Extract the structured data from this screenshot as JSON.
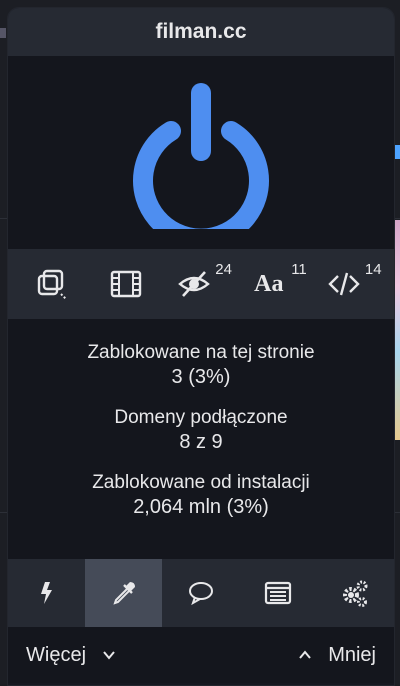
{
  "header": {
    "title": "filman.cc"
  },
  "power": {
    "icon": "power-icon",
    "state": "on",
    "color": "#4e8ef0"
  },
  "icon_row": [
    {
      "name": "no-popups-icon",
      "badge": ""
    },
    {
      "name": "no-media-icon",
      "badge": ""
    },
    {
      "name": "no-cosmetic-icon",
      "badge": "24"
    },
    {
      "name": "no-remote-fonts-icon",
      "glyph": "Aa",
      "badge": "11"
    },
    {
      "name": "no-scripting-icon",
      "badge": "14"
    }
  ],
  "stats": {
    "blocked_page_label": "Zablokowane na tej stronie",
    "blocked_page_value": "3 (3%)",
    "domains_label": "Domeny podłączone",
    "domains_value": "8 z 9",
    "blocked_total_label": "Zablokowane od instalacji",
    "blocked_total_value": "2,064 mln (3%)"
  },
  "tools": [
    {
      "name": "bolt-icon"
    },
    {
      "name": "eyedropper-icon",
      "active": true
    },
    {
      "name": "chat-bubble-icon"
    },
    {
      "name": "list-icon"
    },
    {
      "name": "gears-icon"
    }
  ],
  "footer": {
    "more_label": "Więcej",
    "less_label": "Mniej"
  },
  "colors": {
    "accent": "#4e8ef0",
    "panel": "#262a33",
    "body": "#14161d"
  }
}
